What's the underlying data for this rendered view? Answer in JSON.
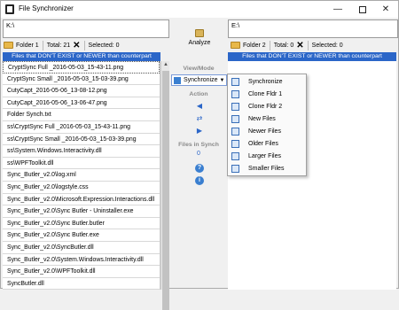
{
  "window": {
    "title": "File Synchronizer",
    "minimize": "—",
    "close": "✕"
  },
  "left": {
    "path": "K:\\",
    "toolbar": {
      "folder_label": "Folder 1",
      "total_label": "Total: 21",
      "selected_label": "Selected: 0"
    },
    "header": "Files that DON'T EXIST or NEWER than counterpart",
    "files": [
      "CryptSync Full _2016-05-03_15-43-11.png",
      "CryptSync Small _2016-05-03_15-03-39.png",
      "CutyCapt_2016-05-06_13-08-12.png",
      "CutyCapt_2016-05-06_13-06-47.png",
      "Folder Synch.txt",
      "ss\\CryptSync Full _2016-05-03_15-43-11.png",
      "ss\\CryptSync Small _2016-05-03_15-03-39.png",
      "ss\\System.Windows.Interactivity.dll",
      "ss\\WPFToolkit.dll",
      "Sync_Butler_v2.0\\log.xml",
      "Sync_Butler_v2.0\\logstyle.css",
      "Sync_Butler_v2.0\\Microsoft.Expression.Interactions.dll",
      "Sync_Butler_v2.0\\Sync Butler - Uninstaller.exe",
      "Sync_Butler_v2.0\\Sync Butler.butler",
      "Sync_Butler_v2.0\\Sync Butler.exe",
      "Sync_Butler_v2.0\\SyncButler.dll",
      "Sync_Butler_v2.0\\System.Windows.Interactivity.dll",
      "Sync_Butler_v2.0\\WPFToolkit.dll",
      "SyncButler.dll"
    ]
  },
  "right": {
    "path": "E:\\",
    "toolbar": {
      "folder_label": "Folder 2",
      "total_label": "Total: 0",
      "selected_label": "Selected: 0"
    },
    "header": "Files that DON'T EXIST or NEWER than counterpart"
  },
  "center": {
    "analyze_label": "Analyze",
    "view_mode_label": "View/Mode",
    "sync_select": "Synchronize",
    "action_label": "Action",
    "files_in_synch_label": "Files in Synch",
    "files_in_synch_count": "0"
  },
  "menu": {
    "items": [
      "Synchronize",
      "Clone Fldr 1",
      "Clone Fldr 2",
      "New Files",
      "Newer Files",
      "Older Files",
      "Larger Files",
      "Smaller Files"
    ]
  },
  "icons": {
    "analyze": "analyze-folder-icon",
    "folder": "folder-icon",
    "clear": "clear-x-icon",
    "help": "help-icon",
    "info": "info-icon"
  },
  "colors": {
    "accent": "#2b66c8",
    "header_bar": "#2b66c8"
  }
}
